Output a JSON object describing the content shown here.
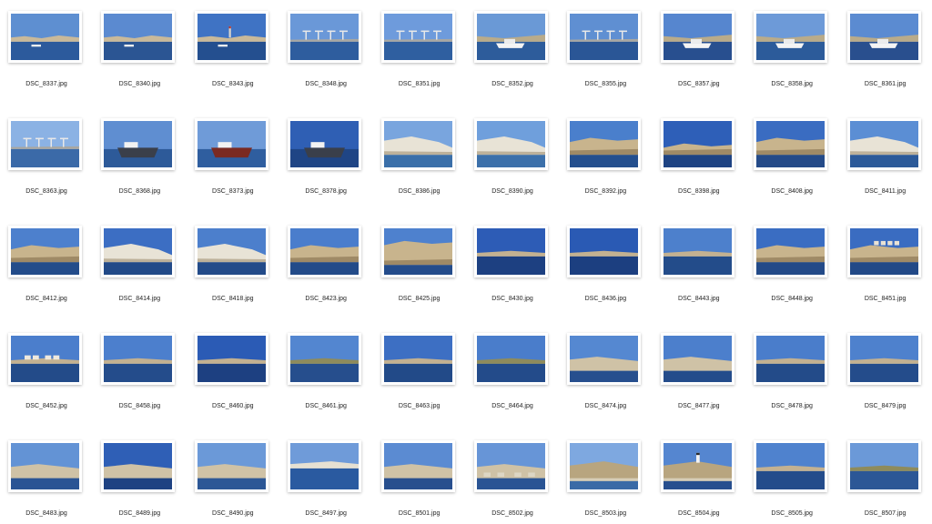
{
  "window": {
    "background": "#ffffff"
  },
  "photos": [
    {
      "name": "DSC_8337.jpg",
      "scene": "harbor",
      "sky": "#5e8fd1",
      "sea": "#2c5a9c"
    },
    {
      "name": "DSC_8340.jpg",
      "scene": "harbor",
      "sky": "#5b8ad0",
      "sea": "#2b5593"
    },
    {
      "name": "DSC_8343.jpg",
      "scene": "harbor-tower",
      "sky": "#3f73c4",
      "sea": "#244f8f"
    },
    {
      "name": "DSC_8348.jpg",
      "scene": "cranes",
      "sky": "#6a98d8",
      "sea": "#2e5d9e"
    },
    {
      "name": "DSC_8351.jpg",
      "scene": "cranes",
      "sky": "#6e9bdc",
      "sea": "#2f5fa0"
    },
    {
      "name": "DSC_8352.jpg",
      "scene": "boat",
      "sky": "#6a99d6",
      "sea": "#2d5c9b"
    },
    {
      "name": "DSC_8355.jpg",
      "scene": "cranes",
      "sky": "#5f8fd2",
      "sea": "#2a5696"
    },
    {
      "name": "DSC_8357.jpg",
      "scene": "boat",
      "sky": "#5686cf",
      "sea": "#284f8f"
    },
    {
      "name": "DSC_8358.jpg",
      "scene": "boat",
      "sky": "#6d9ad8",
      "sea": "#2c5b9a"
    },
    {
      "name": "DSC_8361.jpg",
      "scene": "boat",
      "sky": "#5b8bd1",
      "sea": "#294f8e"
    },
    {
      "name": "DSC_8363.jpg",
      "scene": "cranes",
      "sky": "#8bb2e4",
      "sea": "#3b6aa8"
    },
    {
      "name": "DSC_8368.jpg",
      "scene": "ship",
      "sky": "#5f8ed1",
      "sea": "#2d5a99"
    },
    {
      "name": "DSC_8373.jpg",
      "scene": "ship-red",
      "sky": "#6f9bd8",
      "sea": "#2f5e9f"
    },
    {
      "name": "DSC_8378.jpg",
      "scene": "ship",
      "sky": "#2f5fb4",
      "sea": "#1f4585"
    },
    {
      "name": "DSC_8386.jpg",
      "scene": "cliff-white",
      "sky": "#79a5de",
      "sea": "#3a6fa9"
    },
    {
      "name": "DSC_8390.jpg",
      "scene": "cliff-white",
      "sky": "#6f9fdc",
      "sea": "#3c70aa"
    },
    {
      "name": "DSC_8392.jpg",
      "scene": "cliff",
      "sky": "#4a7fcc",
      "sea": "#244f8e"
    },
    {
      "name": "DSC_8398.jpg",
      "scene": "cliff-low",
      "sky": "#2e5fb8",
      "sea": "#1e4383"
    },
    {
      "name": "DSC_8408.jpg",
      "scene": "cliff",
      "sky": "#3a6cc1",
      "sea": "#244a88"
    },
    {
      "name": "DSC_8411.jpg",
      "scene": "cliff-white",
      "sky": "#5b8ed4",
      "sea": "#2c5a99"
    },
    {
      "name": "DSC_8412.jpg",
      "scene": "cliff",
      "sky": "#4d80cd",
      "sea": "#234c8a"
    },
    {
      "name": "DSC_8414.jpg",
      "scene": "cliff-white",
      "sky": "#3c6ec3",
      "sea": "#224a88"
    },
    {
      "name": "DSC_8418.jpg",
      "scene": "cliff-white",
      "sky": "#4c7fcc",
      "sea": "#234b89"
    },
    {
      "name": "DSC_8423.jpg",
      "scene": "cliff",
      "sky": "#4a7dcc",
      "sea": "#234b89"
    },
    {
      "name": "DSC_8425.jpg",
      "scene": "cliff-tall",
      "sky": "#4e81ce",
      "sea": "#244c8b"
    },
    {
      "name": "DSC_8430.jpg",
      "scene": "coast-low",
      "sky": "#2d5cb6",
      "sea": "#1d4081"
    },
    {
      "name": "DSC_8436.jpg",
      "scene": "coast-low",
      "sky": "#2a5ab4",
      "sea": "#1c3f80"
    },
    {
      "name": "DSC_8443.jpg",
      "scene": "coast-low",
      "sky": "#4d80cc",
      "sea": "#234c8a"
    },
    {
      "name": "DSC_8448.jpg",
      "scene": "cliff",
      "sky": "#3a6dc2",
      "sea": "#234a88"
    },
    {
      "name": "DSC_8451.jpg",
      "scene": "cliff-town",
      "sky": "#3a6cc1",
      "sea": "#224987"
    },
    {
      "name": "DSC_8452.jpg",
      "scene": "coast-town",
      "sky": "#4b7ecc",
      "sea": "#234b89"
    },
    {
      "name": "DSC_8458.jpg",
      "scene": "coast-low",
      "sky": "#4c7fcd",
      "sea": "#244c8b"
    },
    {
      "name": "DSC_8460.jpg",
      "scene": "coast-low",
      "sky": "#2b5bb5",
      "sea": "#1d4081"
    },
    {
      "name": "DSC_8461.jpg",
      "scene": "coast-green",
      "sky": "#5386d0",
      "sea": "#264e8d"
    },
    {
      "name": "DSC_8463.jpg",
      "scene": "coast-low",
      "sky": "#3d6fc3",
      "sea": "#224a88"
    },
    {
      "name": "DSC_8464.jpg",
      "scene": "coast-green",
      "sky": "#4a7dcb",
      "sea": "#234b8a"
    },
    {
      "name": "DSC_8474.jpg",
      "scene": "rocks",
      "sky": "#5588d1",
      "sea": "#274f8e"
    },
    {
      "name": "DSC_8477.jpg",
      "scene": "rocks",
      "sky": "#4c7fcc",
      "sea": "#244c8b"
    },
    {
      "name": "DSC_8478.jpg",
      "scene": "coast-low",
      "sky": "#4a7dcb",
      "sea": "#234b89"
    },
    {
      "name": "DSC_8479.jpg",
      "scene": "coast-low",
      "sky": "#4e81cd",
      "sea": "#244c8b"
    },
    {
      "name": "DSC_8483.jpg",
      "scene": "rocks",
      "sky": "#6393d5",
      "sea": "#2a5494"
    },
    {
      "name": "DSC_8489.jpg",
      "scene": "rocks",
      "sky": "#2f5fb6",
      "sea": "#1e4282"
    },
    {
      "name": "DSC_8490.jpg",
      "scene": "rocks",
      "sky": "#6b99d8",
      "sea": "#2c5796"
    },
    {
      "name": "DSC_8497.jpg",
      "scene": "sea-wide",
      "sky": "#6f9bd9",
      "sea": "#2a5aa0"
    },
    {
      "name": "DSC_8501.jpg",
      "scene": "rocks",
      "sky": "#5b8bd2",
      "sea": "#284f8e"
    },
    {
      "name": "DSC_8502.jpg",
      "scene": "rocks-rubble",
      "sky": "#6795d7",
      "sea": "#2a5494"
    },
    {
      "name": "DSC_8503.jpg",
      "scene": "hillside",
      "sky": "#7ea8e0",
      "sea": "#3a6aa6"
    },
    {
      "name": "DSC_8504.jpg",
      "scene": "hillside-tower",
      "sky": "#5586d0",
      "sea": "#274f8e"
    },
    {
      "name": "DSC_8505.jpg",
      "scene": "coast-low",
      "sky": "#4f82ce",
      "sea": "#244c8b"
    },
    {
      "name": "DSC_8507.jpg",
      "scene": "coast-green",
      "sky": "#6b99d8",
      "sea": "#2c5796"
    }
  ]
}
